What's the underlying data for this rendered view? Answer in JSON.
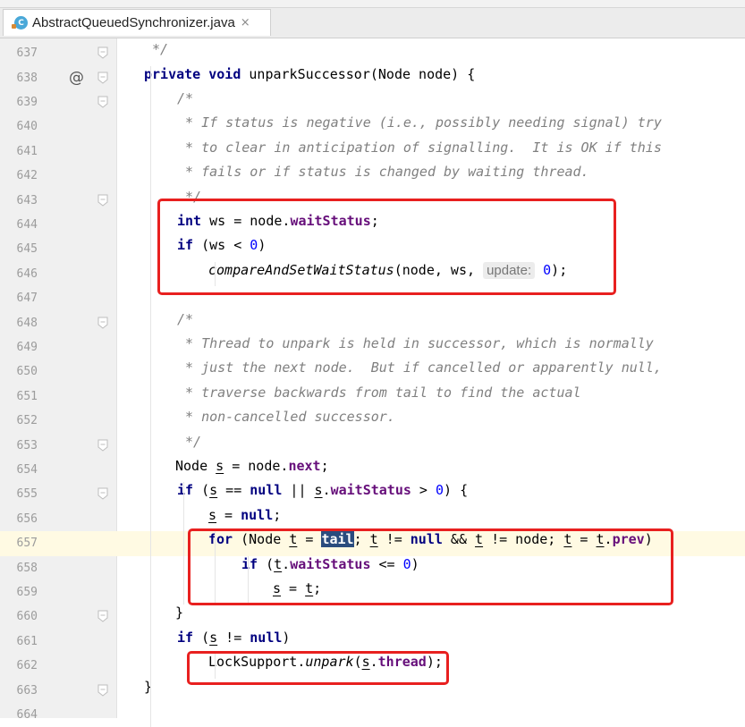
{
  "tab": {
    "icon_letter": "C",
    "title": "AbstractQueuedSynchronizer.java",
    "close": "×"
  },
  "lines": [
    {
      "n": "637",
      "fold": true,
      "code": [
        {
          "t": "*/",
          "c": "cm"
        }
      ]
    },
    {
      "n": "638",
      "fold": true,
      "override": "@",
      "code": [
        {
          "t": "private",
          "c": "kw"
        },
        {
          "t": " "
        },
        {
          "t": "void",
          "c": "kw"
        },
        {
          "t": " unparkSuccessor(Node node) {"
        }
      ]
    },
    {
      "n": "639",
      "fold": true,
      "code": [
        {
          "t": "/*",
          "c": "cm"
        }
      ]
    },
    {
      "n": "640",
      "code": [
        {
          "t": " * If status is negative (i.e., possibly needing signal) try",
          "c": "cm"
        }
      ]
    },
    {
      "n": "641",
      "code": [
        {
          "t": " * to clear in anticipation of signalling.  It is OK if this",
          "c": "cm"
        }
      ]
    },
    {
      "n": "642",
      "code": [
        {
          "t": " * fails or if status is changed by waiting thread.",
          "c": "cm"
        }
      ]
    },
    {
      "n": "643",
      "fold": true,
      "code": [
        {
          "t": " */",
          "c": "cm"
        }
      ]
    },
    {
      "n": "644",
      "code": [
        {
          "t": "int",
          "c": "kw"
        },
        {
          "t": " ws = node."
        },
        {
          "t": "waitStatus",
          "c": "fld"
        },
        {
          "t": ";"
        }
      ]
    },
    {
      "n": "645",
      "code": [
        {
          "t": "if",
          "c": "kw"
        },
        {
          "t": " (ws < "
        },
        {
          "t": "0",
          "c": "num"
        },
        {
          "t": ")"
        }
      ]
    },
    {
      "n": "646",
      "code": [
        {
          "t": "compareAndSetWaitStatus",
          "c": "call-it"
        },
        {
          "t": "(node, ws, "
        },
        {
          "t": "update:",
          "c": "hint"
        },
        {
          "t": " "
        },
        {
          "t": "0",
          "c": "num"
        },
        {
          "t": ");"
        }
      ]
    },
    {
      "n": "647",
      "code": []
    },
    {
      "n": "648",
      "fold": true,
      "code": [
        {
          "t": "/*",
          "c": "cm"
        }
      ]
    },
    {
      "n": "649",
      "code": [
        {
          "t": " * Thread to unpark is held in successor, which is normally",
          "c": "cm"
        }
      ]
    },
    {
      "n": "650",
      "code": [
        {
          "t": " * just the next node.  But if cancelled or apparently null,",
          "c": "cm"
        }
      ]
    },
    {
      "n": "651",
      "code": [
        {
          "t": " * traverse backwards from tail to find the actual",
          "c": "cm"
        }
      ]
    },
    {
      "n": "652",
      "code": [
        {
          "t": " * non-cancelled successor.",
          "c": "cm"
        }
      ]
    },
    {
      "n": "653",
      "fold": true,
      "code": [
        {
          "t": " */",
          "c": "cm"
        }
      ]
    },
    {
      "n": "654",
      "code": [
        {
          "t": "Node "
        },
        {
          "t": "s",
          "c": "u"
        },
        {
          "t": " = node."
        },
        {
          "t": "next",
          "c": "fld"
        },
        {
          "t": ";"
        }
      ]
    },
    {
      "n": "655",
      "fold": true,
      "code": [
        {
          "t": "if",
          "c": "kw"
        },
        {
          "t": " ("
        },
        {
          "t": "s",
          "c": "u"
        },
        {
          "t": " == "
        },
        {
          "t": "null",
          "c": "kw"
        },
        {
          "t": " || "
        },
        {
          "t": "s",
          "c": "u"
        },
        {
          "t": "."
        },
        {
          "t": "waitStatus",
          "c": "fld"
        },
        {
          "t": " > "
        },
        {
          "t": "0",
          "c": "num"
        },
        {
          "t": ") {"
        }
      ]
    },
    {
      "n": "656",
      "code": [
        {
          "t": "s",
          "c": "u"
        },
        {
          "t": " = "
        },
        {
          "t": "null",
          "c": "kw"
        },
        {
          "t": ";"
        }
      ]
    },
    {
      "n": "657",
      "current": true,
      "code": [
        {
          "t": "for",
          "c": "kw"
        },
        {
          "t": " (Node "
        },
        {
          "t": "t",
          "c": "u"
        },
        {
          "t": " = "
        },
        {
          "t": "tail",
          "c": "sel"
        },
        {
          "t": "; "
        },
        {
          "t": "t",
          "c": "u"
        },
        {
          "t": " != "
        },
        {
          "t": "null",
          "c": "kw"
        },
        {
          "t": " && "
        },
        {
          "t": "t",
          "c": "u"
        },
        {
          "t": " != node; "
        },
        {
          "t": "t",
          "c": "u"
        },
        {
          "t": " = "
        },
        {
          "t": "t",
          "c": "u"
        },
        {
          "t": "."
        },
        {
          "t": "prev",
          "c": "fld"
        },
        {
          "t": ")"
        }
      ]
    },
    {
      "n": "658",
      "code": [
        {
          "t": "if",
          "c": "kw"
        },
        {
          "t": " ("
        },
        {
          "t": "t",
          "c": "u"
        },
        {
          "t": "."
        },
        {
          "t": "waitStatus",
          "c": "fld"
        },
        {
          "t": " <= "
        },
        {
          "t": "0",
          "c": "num"
        },
        {
          "t": ")"
        }
      ]
    },
    {
      "n": "659",
      "code": [
        {
          "t": "s",
          "c": "u"
        },
        {
          "t": " = "
        },
        {
          "t": "t",
          "c": "u"
        },
        {
          "t": ";"
        }
      ]
    },
    {
      "n": "660",
      "fold": true,
      "code": [
        {
          "t": "}"
        }
      ]
    },
    {
      "n": "661",
      "code": [
        {
          "t": "if",
          "c": "kw"
        },
        {
          "t": " ("
        },
        {
          "t": "s",
          "c": "u"
        },
        {
          "t": " != "
        },
        {
          "t": "null",
          "c": "kw"
        },
        {
          "t": ")"
        }
      ]
    },
    {
      "n": "662",
      "code": [
        {
          "t": "LockSupport."
        },
        {
          "t": "unpark",
          "c": "call-it"
        },
        {
          "t": "("
        },
        {
          "t": "s",
          "c": "u"
        },
        {
          "t": "."
        },
        {
          "t": "thread",
          "c": "fld"
        },
        {
          "t": ");"
        }
      ]
    },
    {
      "n": "663",
      "fold": true,
      "code": [
        {
          "t": "}"
        }
      ]
    },
    {
      "n": "664",
      "code": []
    }
  ],
  "colors": {
    "keyword": "#000080",
    "comment": "#808080",
    "field": "#660e7a",
    "number": "#0000ff",
    "selection": "#2a4c7e",
    "current_line": "#fffae3",
    "annotation_box": "#e8201f"
  }
}
